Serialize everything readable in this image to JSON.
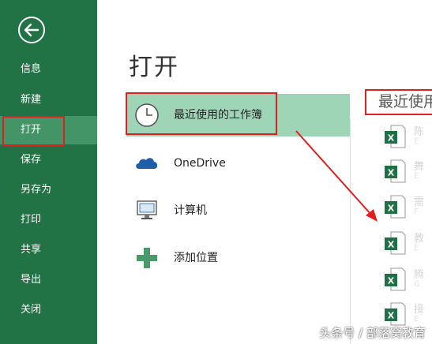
{
  "sidebar": {
    "items": [
      {
        "label": "信息"
      },
      {
        "label": "新建"
      },
      {
        "label": "打开"
      },
      {
        "label": "保存"
      },
      {
        "label": "另存为"
      },
      {
        "label": "打印"
      },
      {
        "label": "共享"
      },
      {
        "label": "导出"
      },
      {
        "label": "关闭"
      }
    ],
    "active": "打开"
  },
  "main": {
    "title": "打开",
    "places": [
      {
        "label": "最近使用的工作簿",
        "icon": "clock-icon"
      },
      {
        "label": "OneDrive",
        "icon": "cloud-icon"
      },
      {
        "label": "计算机",
        "icon": "computer-icon"
      },
      {
        "label": "添加位置",
        "icon": "plus-icon"
      }
    ]
  },
  "recent": {
    "header": "最近使用",
    "files": [
      {
        "name": "陈",
        "sub": "E"
      },
      {
        "name": "舞",
        "sub": "E"
      },
      {
        "name": "需",
        "sub": "F"
      },
      {
        "name": "教",
        "sub": "E"
      },
      {
        "name": "腾",
        "sub": "G"
      },
      {
        "name": "接",
        "sub": "E"
      }
    ]
  },
  "colors": {
    "sidebar": "#217346",
    "selected": "#9fd5b7",
    "excel": "#1e7145",
    "annotation": "#e02020"
  },
  "watermark": "头条号 / 部落窝教育"
}
